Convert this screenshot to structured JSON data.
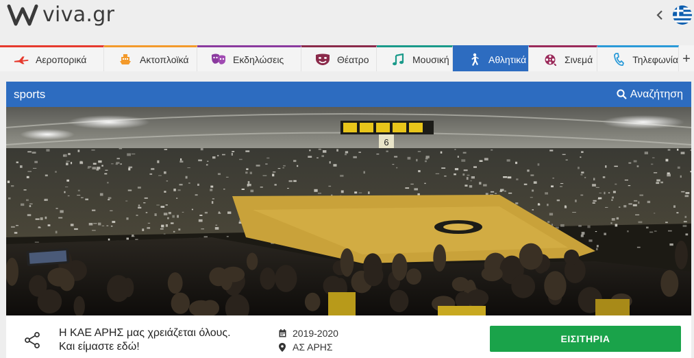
{
  "header": {
    "logo_text": "viva.gr",
    "language_flag_icon": "greek-flag-icon",
    "back_icon": "chevron-left-icon"
  },
  "nav": {
    "items": [
      {
        "label": "Αεροπορικά",
        "icon": "airplane-icon",
        "active": false,
        "accent": "#e63a2e"
      },
      {
        "label": "Ακτοπλοϊκά",
        "icon": "ferry-icon",
        "active": false,
        "accent": "#f39a2b"
      },
      {
        "label": "Εκδηλώσεις",
        "icon": "masks-icon",
        "active": false,
        "accent": "#8a3a9e"
      },
      {
        "label": "Θέατρο",
        "icon": "theater-mask-icon",
        "active": false,
        "accent": "#8a2a4a"
      },
      {
        "label": "Μουσική",
        "icon": "music-note-icon",
        "active": false,
        "accent": "#1a9a8a"
      },
      {
        "label": "Αθλητικά",
        "icon": "runner-icon",
        "active": true,
        "accent": "#2d6cc0"
      },
      {
        "label": "Σινεμά",
        "icon": "film-reel-icon",
        "active": false,
        "accent": "#9a2a5a"
      },
      {
        "label": "Τηλεφωνία",
        "icon": "phone-icon",
        "active": false,
        "accent": "#2a9ad8"
      }
    ],
    "more_label": "+"
  },
  "section": {
    "title": "sports",
    "search_label": "Αναζήτηση"
  },
  "event": {
    "title": "Η ΚΑΕ ΑΡΗΣ μας χρειάζεται όλους. Και είμαστε εδώ!",
    "season": "2019-2020",
    "venue": "ΑΣ ΑΡΗΣ",
    "tickets_label": "ΕΙΣΙΤΗΡΙΑ",
    "score_board_number": "6"
  },
  "colors": {
    "brand_blue": "#2d6cc0",
    "tickets_green": "#1aa34a"
  }
}
